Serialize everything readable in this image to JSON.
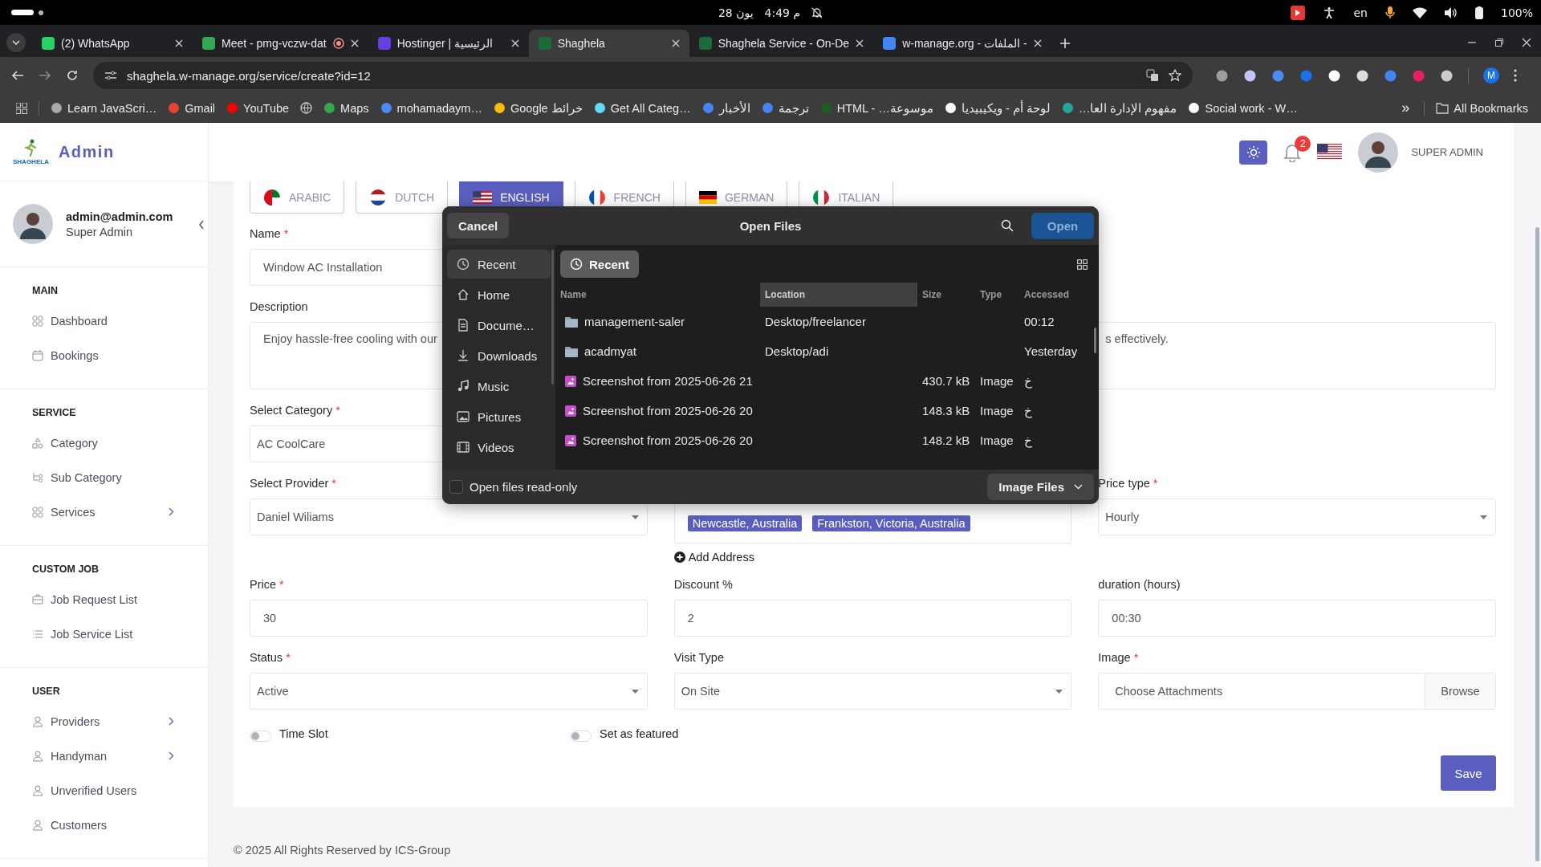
{
  "system_bar": {
    "date": "28 يون",
    "time": "4:49 م",
    "keyboard": "en",
    "battery": "100%"
  },
  "browser": {
    "tabs": [
      {
        "title": "(2) WhatsApp",
        "selected": false,
        "recording": false
      },
      {
        "title": "Meet - pmg-vczw-dat",
        "selected": false,
        "recording": true
      },
      {
        "title": "Hostinger | الرئيسية",
        "selected": false,
        "recording": false
      },
      {
        "title": "Shaghela",
        "selected": true,
        "recording": false
      },
      {
        "title": "Shaghela Service - On-De",
        "selected": false,
        "recording": false
      },
      {
        "title": "w-manage.org - الملفات -",
        "selected": false,
        "recording": false
      }
    ],
    "url": "shaghela.w-manage.org/service/create?id=12",
    "profile_initial": "M",
    "bookmarks": [
      {
        "kind": "link",
        "label": "Learn JavaScri…"
      },
      {
        "kind": "link",
        "label": "Gmail"
      },
      {
        "kind": "link",
        "label": "YouTube"
      },
      {
        "kind": "icon"
      },
      {
        "kind": "link",
        "label": "Maps"
      },
      {
        "kind": "link",
        "label": "mohamadaym…"
      },
      {
        "kind": "link",
        "label": "Google خرائط"
      },
      {
        "kind": "link",
        "label": "Get All Categ…"
      },
      {
        "kind": "link",
        "label": "الأخبار"
      },
      {
        "kind": "link",
        "label": "ترجمة"
      },
      {
        "kind": "link",
        "label": "HTML - …موسوعة"
      },
      {
        "kind": "link",
        "label": "لوحة أم - ويكيبيديا"
      },
      {
        "kind": "link",
        "label": "…مفهوم الإدارة العا"
      },
      {
        "kind": "link",
        "label": "Social work - W…"
      }
    ],
    "more_bookmarks": "»",
    "all_bookmarks": "All Bookmarks"
  },
  "app": {
    "logo_text": "SHAGHELA",
    "title": "Admin",
    "user_email": "admin@admin.com",
    "user_role": "Super Admin",
    "notification_count": "2",
    "header_role": "SUPER ADMIN"
  },
  "sidebar": {
    "sections": [
      {
        "heading": "MAIN",
        "items": [
          {
            "label": "Dashboard",
            "expandable": false
          },
          {
            "label": "Bookings",
            "expandable": false
          }
        ]
      },
      {
        "heading": "SERVICE",
        "items": [
          {
            "label": "Category",
            "expandable": false
          },
          {
            "label": "Sub Category",
            "expandable": false
          },
          {
            "label": "Services",
            "expandable": true
          }
        ]
      },
      {
        "heading": "CUSTOM JOB",
        "items": [
          {
            "label": "Job Request List",
            "expandable": false
          },
          {
            "label": "Job Service List",
            "expandable": false
          }
        ]
      },
      {
        "heading": "USER",
        "items": [
          {
            "label": "Providers",
            "expandable": true
          },
          {
            "label": "Handyman",
            "expandable": true
          },
          {
            "label": "Unverified Users",
            "expandable": false
          },
          {
            "label": "Customers",
            "expandable": false
          }
        ]
      }
    ]
  },
  "languages": [
    {
      "label": "ARABIC",
      "selected": false
    },
    {
      "label": "DUTCH",
      "selected": false
    },
    {
      "label": "ENGLISH",
      "selected": true
    },
    {
      "label": "FRENCH",
      "selected": false
    },
    {
      "label": "GERMAN",
      "selected": false
    },
    {
      "label": "ITALIAN",
      "selected": false
    }
  ],
  "form": {
    "name": {
      "label": "Name",
      "required_mark": "*",
      "value": "Window AC Installation"
    },
    "description": {
      "label": "Description",
      "visible_text": [
        "Enjoy hassle-free cooling with our",
        "s effectively."
      ]
    },
    "category": {
      "label": "Select Category",
      "required_mark": "*",
      "value": "AC CoolCare"
    },
    "provider": {
      "label": "Select Provider",
      "required_mark": "*",
      "value": "Daniel Wiliams"
    },
    "addresses": [
      "Newcastle, Australia",
      "Frankston, Victoria, Australia"
    ],
    "add_address": "Add Address",
    "price_type": {
      "label": "Price type",
      "required_mark": "*",
      "value": "Hourly"
    },
    "price": {
      "label": "Price",
      "required_mark": "*",
      "value": "30"
    },
    "discount": {
      "label": "Discount %",
      "value": "2"
    },
    "duration": {
      "label": "duration (hours)",
      "value": "00:30"
    },
    "status": {
      "label": "Status",
      "required_mark": "*",
      "value": "Active"
    },
    "visit_type": {
      "label": "Visit Type",
      "value": "On Site"
    },
    "image": {
      "label": "Image",
      "required_mark": "*",
      "placeholder": "Choose Attachments",
      "button": "Browse"
    },
    "toggles": [
      {
        "label": "Time Slot",
        "on": false
      },
      {
        "label": "Set as featured",
        "on": false
      }
    ],
    "save": "Save"
  },
  "file_dialog": {
    "title": "Open Files",
    "cancel": "Cancel",
    "open": "Open",
    "location_chip": "Recent",
    "places": [
      {
        "label": "Recent",
        "selected": true
      },
      {
        "label": "Home",
        "selected": false
      },
      {
        "label": "Docume…",
        "selected": false
      },
      {
        "label": "Downloads",
        "selected": false
      },
      {
        "label": "Music",
        "selected": false
      },
      {
        "label": "Pictures",
        "selected": false
      },
      {
        "label": "Videos",
        "selected": false
      }
    ],
    "columns": [
      {
        "label": "Name",
        "selected": false
      },
      {
        "label": "Location",
        "selected": true
      },
      {
        "label": "Size",
        "selected": false
      },
      {
        "label": "Type",
        "selected": false
      },
      {
        "label": "Accessed",
        "selected": false
      }
    ],
    "rows": [
      {
        "kind": "folder",
        "name": "management-saler",
        "location": "Desktop/freelancer",
        "accessed": "00:12"
      },
      {
        "kind": "folder",
        "name": "acadmyat",
        "location": "Desktop/adi",
        "accessed": "Yesterday"
      },
      {
        "kind": "image",
        "name": "Screenshot from 2025-06-26 21",
        "size": "430.7 kB",
        "type": "Image",
        "accessed": "خ"
      },
      {
        "kind": "image",
        "name": "Screenshot from 2025-06-26 20",
        "size": "148.3 kB",
        "type": "Image",
        "accessed": "خ"
      },
      {
        "kind": "image",
        "name": "Screenshot from 2025-06-26 20",
        "size": "148.2 kB",
        "type": "Image",
        "accessed": "خ"
      }
    ],
    "read_only": {
      "label": "Open files read-only",
      "checked": false
    },
    "filter": "Image Files"
  },
  "footer": "© 2025 All Rights Reserved by ICS-Group"
}
